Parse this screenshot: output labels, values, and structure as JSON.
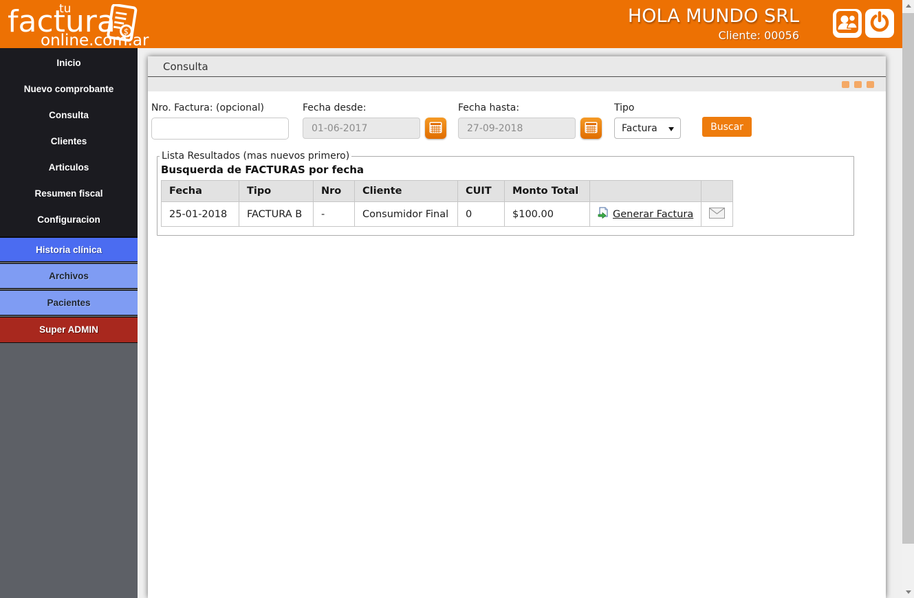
{
  "header": {
    "logo_tu": "tu",
    "logo_main": "factura",
    "logo_domain": "online.com.ar",
    "company": "HOLA MUNDO SRL",
    "client": "Cliente: 00056"
  },
  "sidebar": {
    "items": [
      {
        "label": "Inicio"
      },
      {
        "label": "Nuevo comprobante"
      },
      {
        "label": "Consulta"
      },
      {
        "label": "Clientes"
      },
      {
        "label": "Articulos"
      },
      {
        "label": "Resumen fiscal"
      },
      {
        "label": "Configuracion"
      }
    ],
    "modules": [
      {
        "label": "Historia clínica",
        "bg": "#4b6cf1"
      },
      {
        "label": "Archivos",
        "bg": "#7f9cf3"
      },
      {
        "label": "Pacientes",
        "bg": "#7f9cf3"
      },
      {
        "label": "Super ADMIN",
        "bg": "#a8281e"
      }
    ]
  },
  "main": {
    "title": "Consulta",
    "form": {
      "nro_label": "Nro. Factura: (opcional)",
      "nro_value": "",
      "fecha_desde_label": "Fecha desde:",
      "fecha_desde_value": "01-06-2017",
      "fecha_hasta_label": "Fecha hasta:",
      "fecha_hasta_value": "27-09-2018",
      "tipo_label": "Tipo",
      "tipo_value": "Factura",
      "buscar_label": "Buscar"
    },
    "results": {
      "legend": "Lista Resultados (mas nuevos primero)",
      "heading": "Busquerda de FACTURAS por fecha",
      "table": {
        "headers": [
          "Fecha",
          "Tipo",
          "Nro",
          "Cliente",
          "CUIT",
          "Monto Total"
        ],
        "rows": [
          {
            "fecha": "25-01-2018",
            "tipo": "FACTURA B",
            "nro": "-",
            "cliente": "Consumidor Final",
            "cuit": "0",
            "monto": "$100.00",
            "action": "Generar Factura"
          }
        ]
      }
    }
  },
  "colors": {
    "header_orange": "#ed7103",
    "accent_button_orange": "#ee7c0d",
    "sidebar_dark": "#1b1b20",
    "sidebar_gray": "#5d6066",
    "module_blue": "#4b6cf1",
    "module_light_blue": "#7f9cf3",
    "module_red": "#a8281e",
    "tipo_text_red": "#9c3a33"
  }
}
